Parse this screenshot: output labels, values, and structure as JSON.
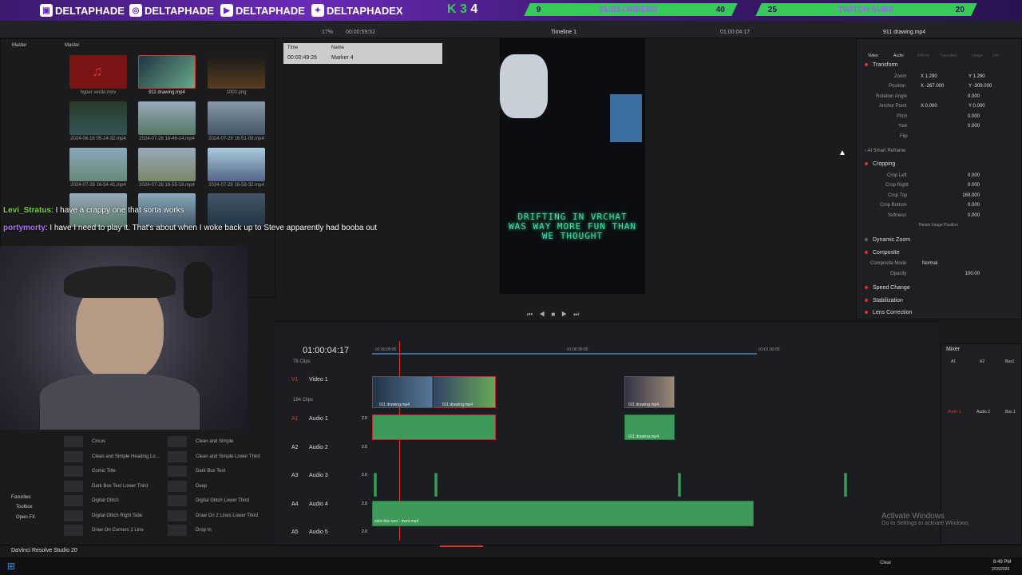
{
  "banner": {
    "socials": [
      "DELTAPHADE",
      "DELTAPHADE",
      "DELTAPHADE",
      "DELTAPHADEX"
    ],
    "k_count": "K 3",
    "k_num": "4",
    "goal1": {
      "left": "9",
      "label": "SUBSCRIBERS",
      "right": "40"
    },
    "goal2": {
      "left": "25",
      "label": "TWITCH SUBS",
      "right": "20"
    },
    "accent": "#38c95a"
  },
  "toolbar": {
    "master1": "Master",
    "master2": "Master",
    "zoom": "17%",
    "timecode_top": "00:00:59:52",
    "timeline_name": "Timeline 1",
    "timecode_right": "01:00:04:17",
    "inspector_file": "911 drawing.mp4"
  },
  "markers": {
    "time_head": "Time",
    "name_head": "Name",
    "time": "00:00:49:26",
    "name": "Marker 4"
  },
  "media": [
    {
      "label": "hyper verde.mov"
    },
    {
      "label": "911 drawing.mp4"
    },
    {
      "label": "1000.png"
    },
    {
      "label": "2024-06-16 05-24-32.mp4"
    },
    {
      "label": "2024-07-28 16-46-14.mp4"
    },
    {
      "label": "2024-07-28 16-51-08.mp4"
    },
    {
      "label": "2024-07-28 16-54-41.mp4"
    },
    {
      "label": "2024-07-28 16-55-18.mp4"
    },
    {
      "label": "2024-07-28 16-58-32.mp4"
    }
  ],
  "chat": [
    {
      "user": "Levi_Stratus",
      "msg": ": I have a crappy one that sorta works"
    },
    {
      "user": "portymorty",
      "msg": ": I have I need to play it. That's about when I woke back up to Steve apparently had booba out"
    }
  ],
  "viewer": {
    "overlay_text": "DRIFTING IN VRCHAT WAS WAY MORE FUN THAN WE THOUGHT"
  },
  "inspector": {
    "tabs": [
      "Video",
      "Audio",
      "Effects",
      "Transition",
      "Image",
      "File"
    ],
    "transform_title": "Transform",
    "rows": [
      {
        "label": "Zoom",
        "x": "X 1.290",
        "y": "Y 1.290"
      },
      {
        "label": "Position",
        "x": "X -267.000",
        "y": "Y -309.000"
      },
      {
        "label": "Rotation Angle",
        "v": "0.000"
      },
      {
        "label": "Anchor Point",
        "x": "X 0.000",
        "y": "Y 0.000"
      },
      {
        "label": "Pitch",
        "v": "0.000"
      },
      {
        "label": "Yaw",
        "v": "0.000"
      },
      {
        "label": "Flip",
        "v": ""
      }
    ],
    "smart_reframe": "AI Smart Reframe",
    "cropping_title": "Cropping",
    "crop_rows": [
      {
        "label": "Crop Left",
        "v": "0.000"
      },
      {
        "label": "Crop Right",
        "v": "0.000"
      },
      {
        "label": "Crop Top",
        "v": "169.000"
      },
      {
        "label": "Crop Bottom",
        "v": "0.000"
      },
      {
        "label": "Softness",
        "v": "0.000"
      }
    ],
    "retain": "Retain Image Position",
    "dynamic_zoom": "Dynamic Zoom",
    "composite_title": "Composite",
    "composite_mode_label": "Composite Mode",
    "composite_mode": "Normal",
    "opacity_label": "Opacity",
    "opacity": "100.00",
    "speed_change": "Speed Change",
    "stabilization": "Stabilization",
    "lens_correction": "Lens Correction"
  },
  "timeline": {
    "timecode": "01:00:04:17",
    "ruler": [
      "01:00:00:00",
      "01:00:30:00",
      "01:01:00:00"
    ],
    "clips_count": "78 Clips",
    "clips_count2": "184 Clips",
    "tracks": [
      {
        "id": "V1",
        "name": "Video 1"
      },
      {
        "id": "A1",
        "name": "Audio 1",
        "lvl": "2.0"
      },
      {
        "id": "A2",
        "name": "Audio 2",
        "lvl": "2.0"
      },
      {
        "id": "A3",
        "name": "Audio 3",
        "lvl": "2.0"
      },
      {
        "id": "A4",
        "name": "Audio 4",
        "lvl": "2.0"
      },
      {
        "id": "A5",
        "name": "Audio 5",
        "lvl": "2.0"
      }
    ],
    "clip_name": "911 drawing.mp4",
    "audio4_clip": "stick this torn - dwnt.mp4"
  },
  "mixer": {
    "title": "Mixer",
    "channels": [
      "A1",
      "A2",
      "Bus1"
    ],
    "bottom": [
      "Audio 1",
      "Audio 2",
      "Bus 1"
    ]
  },
  "effects": [
    [
      "Circus",
      "Clean and Simple"
    ],
    [
      "Clean and Simple Heading Lo...",
      "Clean and Simple Lower Third"
    ],
    [
      "Comic Title",
      "Dark Box Text"
    ],
    [
      "Dark Box Text Lower Third",
      "Deep"
    ],
    [
      "Digital Glitch",
      "Digital Glitch Lower Third"
    ],
    [
      "Digital Glitch Right Side",
      "Draw On 2 Lines Lower Third"
    ],
    [
      "Draw On Corners 1 Line",
      "Drop In"
    ]
  ],
  "sidebar": [
    "Favorites",
    "Toolbox",
    "Open FX"
  ],
  "app_name": "DaVinci Resolve Studio 20",
  "activate": {
    "line1": "Activate Windows",
    "line2": "Go to Settings to activate Windows."
  },
  "tray": {
    "weather": "Clear",
    "time": "8:49 PM",
    "date": "2/15/2026"
  }
}
